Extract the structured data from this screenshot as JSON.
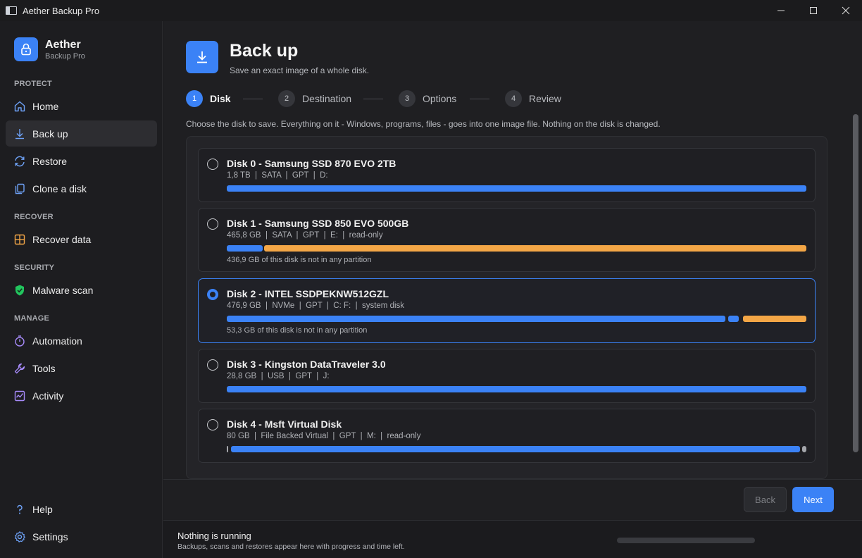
{
  "window": {
    "title": "Aether Backup Pro",
    "controls": [
      "minimize",
      "maximize",
      "close"
    ]
  },
  "brand": {
    "name": "Aether",
    "sub": "Backup Pro"
  },
  "sidebar": {
    "sections": {
      "protect": "PROTECT",
      "recover": "RECOVER",
      "security": "SECURITY",
      "manage": "MANAGE"
    },
    "items": {
      "home": "Home",
      "backup": "Back up",
      "restore": "Restore",
      "clone": "Clone a disk",
      "recover": "Recover data",
      "malware": "Malware scan",
      "automation": "Automation",
      "tools": "Tools",
      "activity": "Activity",
      "help": "Help",
      "settings": "Settings"
    },
    "active": "backup"
  },
  "header": {
    "title": "Back up",
    "subtitle": "Save an exact image of a whole disk."
  },
  "steps": [
    {
      "num": "1",
      "label": "Disk",
      "active": true
    },
    {
      "num": "2",
      "label": "Destination",
      "active": false
    },
    {
      "num": "3",
      "label": "Options",
      "active": false
    },
    {
      "num": "4",
      "label": "Review",
      "active": false
    }
  ],
  "instruction": "Choose the disk to save. Everything on it - Windows, programs, files - goes into one image file. Nothing on the disk is changed.",
  "disks": [
    {
      "name": "Disk 0 - Samsung SSD 870 EVO 2TB",
      "meta": "1,8 TB  |  SATA  |  GPT  |  D:",
      "note": "",
      "selected": false
    },
    {
      "name": "Disk 1 - Samsung SSD 850 EVO 500GB",
      "meta": "465,8 GB  |  SATA  |  GPT  |  E:  |  read-only",
      "note": "436,9 GB of this disk is not in any partition",
      "selected": false
    },
    {
      "name": "Disk 2 - INTEL SSDPEKNW512GZL",
      "meta": "476,9 GB  |  NVMe  |  GPT  |  C: F:  |  system disk",
      "note": "53,3 GB of this disk is not in any partition",
      "selected": true
    },
    {
      "name": "Disk 3 - Kingston DataTraveler 3.0",
      "meta": "28,8 GB  |  USB  |  GPT  |  J:",
      "note": "",
      "selected": false
    },
    {
      "name": "Disk 4 - Msft Virtual Disk",
      "meta": "80 GB  |  File Backed Virtual  |  GPT  |  M:  |  read-only",
      "note": "",
      "selected": false
    }
  ],
  "colors": {
    "accent": "#3b82f6",
    "unallocated": "#f3a646",
    "sidebar_bg": "#1d1d20",
    "main_bg": "#1f1f22"
  },
  "buttons": {
    "back": "Back",
    "next": "Next"
  },
  "status": {
    "title": "Nothing is running",
    "subtitle": "Backups, scans and restores appear here with progress and time left."
  }
}
